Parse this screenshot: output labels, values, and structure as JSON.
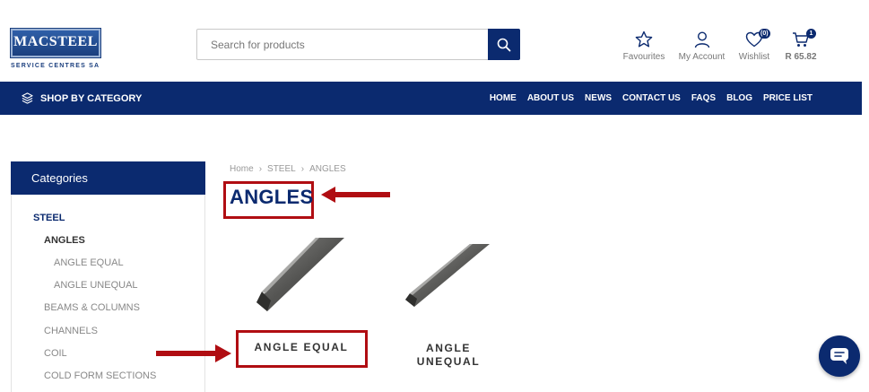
{
  "logo": {
    "name": "MACSTEEL",
    "tagline": "SERVICE CENTRES SA"
  },
  "search": {
    "placeholder": "Search for products"
  },
  "header_actions": {
    "favourites": "Favourites",
    "account": "My Account",
    "wishlist": "Wishlist",
    "wishlist_count": "(0)",
    "cart_total": "R 65.82",
    "cart_count": "1"
  },
  "nav": {
    "shop_by_category": "SHOP BY CATEGORY",
    "links": [
      "HOME",
      "ABOUT US",
      "NEWS",
      "CONTACT US",
      "FAQS",
      "BLOG",
      "PRICE LIST"
    ]
  },
  "sidebar": {
    "heading": "Categories",
    "items": [
      {
        "label": "STEEL",
        "level": 0
      },
      {
        "label": "ANGLES",
        "level": 1,
        "active": true
      },
      {
        "label": "ANGLE EQUAL",
        "level": 2
      },
      {
        "label": "ANGLE UNEQUAL",
        "level": 2
      },
      {
        "label": "BEAMS & COLUMNS",
        "level": 1
      },
      {
        "label": "CHANNELS",
        "level": 1
      },
      {
        "label": "COIL",
        "level": 1
      },
      {
        "label": "COLD FORM SECTIONS",
        "level": 1
      }
    ]
  },
  "breadcrumb": [
    "Home",
    "STEEL",
    "ANGLES"
  ],
  "page_title": "ANGLES",
  "products": [
    {
      "name": "ANGLE EQUAL"
    },
    {
      "name_line1": "ANGLE",
      "name_line2": "UNEQUAL"
    }
  ],
  "colors": {
    "brand": "#0b2a6f",
    "annotation": "#b00d12"
  },
  "icons": [
    "search-icon",
    "star-icon",
    "user-icon",
    "heart-icon",
    "cart-icon",
    "layers-icon",
    "chat-icon"
  ]
}
